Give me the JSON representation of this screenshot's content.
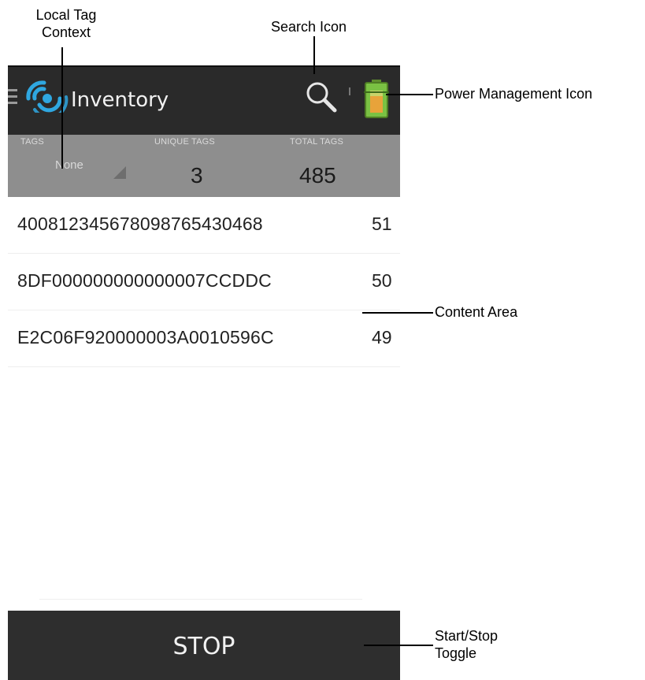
{
  "app": {
    "title": "Inventory"
  },
  "stats": {
    "tags_label": "TAGS",
    "context_value": "None",
    "unique_label": "UNIQUE TAGS",
    "unique_value": "3",
    "total_label": "TOTAL TAGS",
    "total_value": "485"
  },
  "tags": [
    {
      "id": "400812345678098765430468",
      "count": "51"
    },
    {
      "id": "8DF000000000000007CCDDC",
      "count": "50"
    },
    {
      "id": "E2C06F920000003A0010596C",
      "count": "49"
    }
  ],
  "toggle": {
    "label": "STOP"
  },
  "annotations": {
    "local_tag_context_line1": "Local Tag",
    "local_tag_context_line2": "Context",
    "search_icon": "Search Icon",
    "power_management_icon": "Power Management Icon",
    "content_area": "Content Area",
    "start_stop_line1": "Start/Stop",
    "start_stop_line2": "Toggle"
  },
  "icons": {
    "menu": "hamburger-icon",
    "app_logo": "rfid-wave-icon",
    "search": "search-icon",
    "power": "battery-icon"
  },
  "colors": {
    "action_bar": "#2a2a2a",
    "stats_bar": "#8e8e8e",
    "logo_blue": "#2fa7e0",
    "battery_green": "#7ac143",
    "battery_orange": "#e8a33a",
    "stop_bar": "#2e2e2e"
  }
}
